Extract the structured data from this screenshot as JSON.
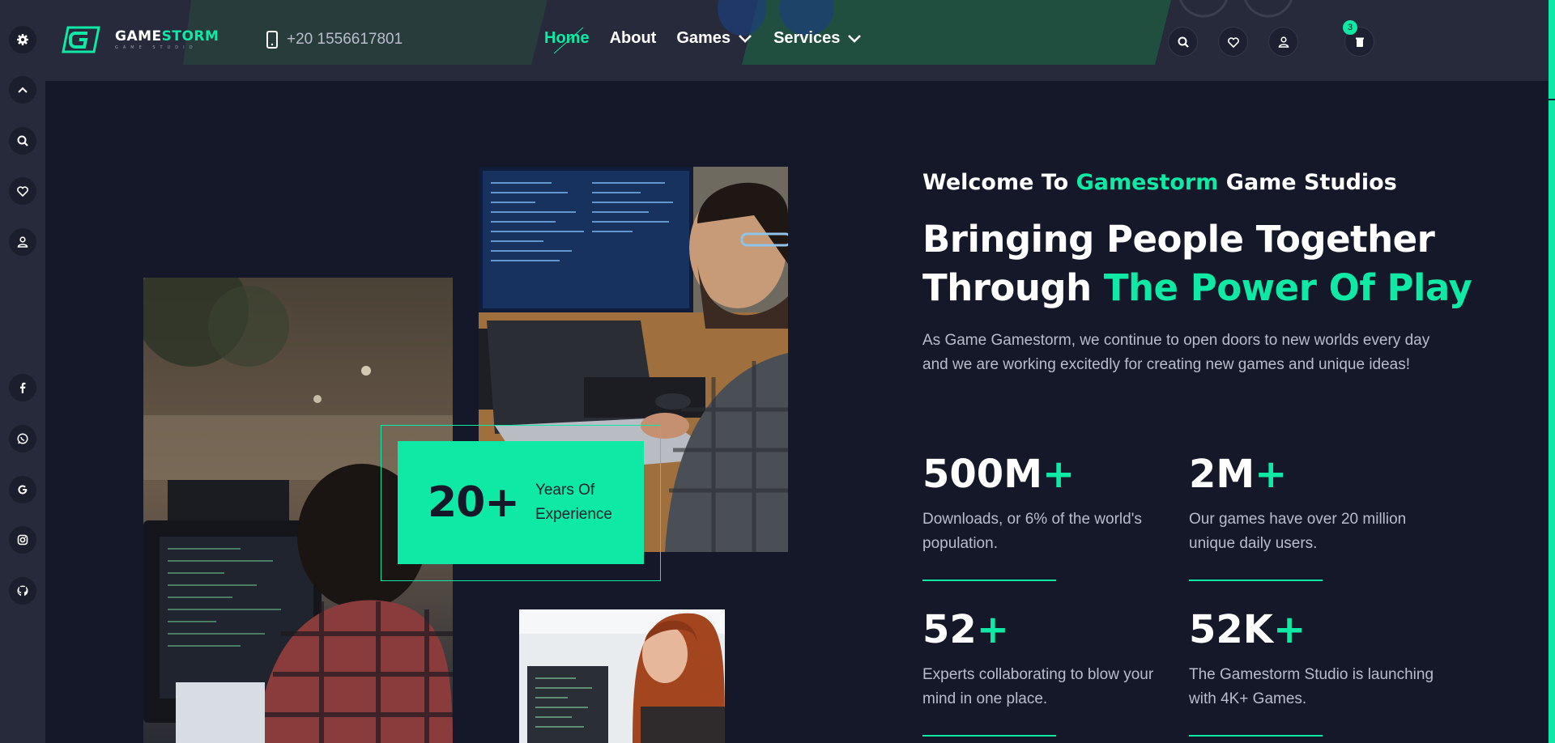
{
  "brand": {
    "name_part1": "GAME",
    "name_part2": "STORM",
    "tagline": "GAME STUDIO"
  },
  "header": {
    "phone": "+20 1556617801",
    "cart_count": "3"
  },
  "nav": {
    "items": [
      {
        "label": "Home",
        "active": true
      },
      {
        "label": "About"
      },
      {
        "label": "Games",
        "has_dropdown": true
      },
      {
        "label": "Services",
        "has_dropdown": true
      }
    ]
  },
  "experience": {
    "number": "20+",
    "label_line1": "Years Of",
    "label_line2": "Experience"
  },
  "hero": {
    "welcome_prefix": "Welcome To ",
    "welcome_brand": "Gamestorm",
    "welcome_suffix": " Game Studios",
    "headline_line1": "Bringing People Together",
    "headline_line2_prefix": "Through ",
    "headline_line2_highlight": "The Power Of Play",
    "intro": "As Game Gamestorm, we continue to open doors to new worlds every day and we are working excitedly for creating new games and unique ideas!"
  },
  "stats": [
    {
      "value": "500M",
      "plus": "+",
      "desc_line1": "Downloads, or 6% of the world's",
      "desc_line2": "population."
    },
    {
      "value": "2M",
      "plus": "+",
      "desc_line1": "Our games have over 20 million",
      "desc_line2": "unique daily users."
    },
    {
      "value": "52",
      "plus": "+",
      "desc_line1": "Experts collaborating to blow your",
      "desc_line2": "mind in one place."
    },
    {
      "value": "52K",
      "plus": "+",
      "desc_line1": "The Gamestorm Studio is launching",
      "desc_line2": "with 4K+ Games."
    }
  ],
  "colors": {
    "accent": "#0eeaa5",
    "background": "#151828",
    "panel": "#262a3a"
  }
}
